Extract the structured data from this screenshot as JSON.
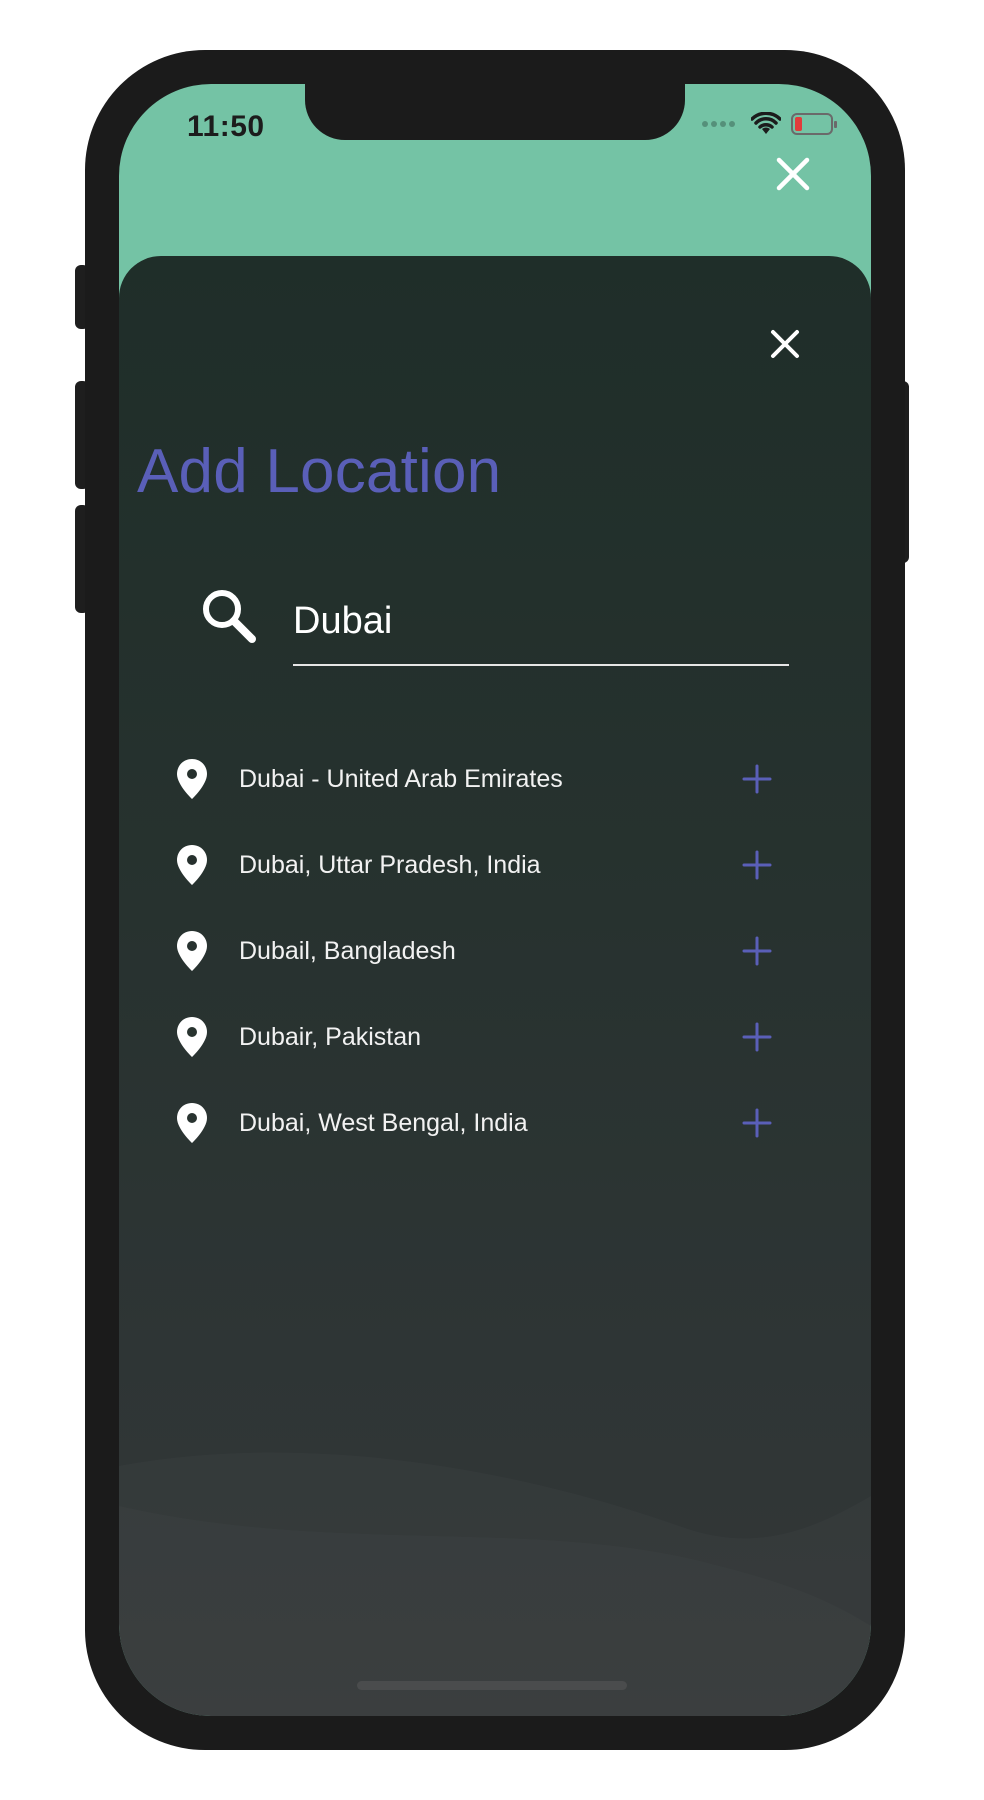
{
  "status_bar": {
    "time": "11:50",
    "icons": [
      "cellular-dots-icon",
      "wifi-icon",
      "battery-low-icon"
    ],
    "battery_color": "#e23b3b"
  },
  "colors": {
    "header_green": "#74c3a5",
    "sheet_dark": "#1f2e29",
    "accent_indigo": "#5a5fb8",
    "text_light": "#f2f2f2"
  },
  "modal": {
    "title": "Add Location",
    "search": {
      "value": "Dubai",
      "icon": "search-icon"
    },
    "results": [
      {
        "label": "Dubai - United Arab Emirates"
      },
      {
        "label": "Dubai, Uttar Pradesh, India"
      },
      {
        "label": "Dubail, Bangladesh"
      },
      {
        "label": "Dubair, Pakistan"
      },
      {
        "label": "Dubai, West Bengal, India"
      }
    ]
  }
}
